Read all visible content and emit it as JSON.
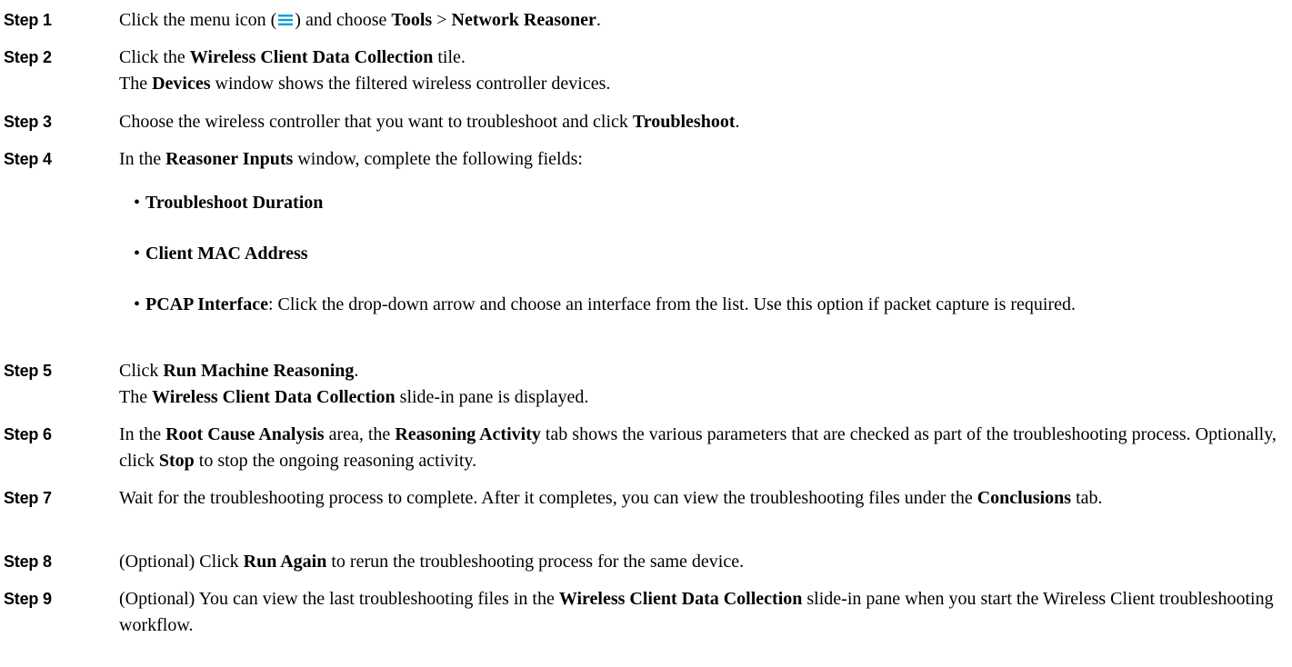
{
  "menu_icon_color": "#049fd9",
  "steps": [
    {
      "label": "Step 1",
      "parts": {
        "t1": "Click the menu icon (",
        "t2": ") and choose ",
        "b1": "Tools",
        "t3": " > ",
        "b2": "Network Reasoner",
        "t4": "."
      }
    },
    {
      "label": "Step 2",
      "parts": {
        "t1": "Click the ",
        "b1": "Wireless Client Data Collection",
        "t2": " tile.",
        "t3": "The ",
        "b2": "Devices",
        "t4": " window shows the filtered wireless controller devices."
      }
    },
    {
      "label": "Step 3",
      "parts": {
        "t1": "Choose the wireless controller that you want to troubleshoot and click ",
        "b1": "Troubleshoot",
        "t2": "."
      }
    },
    {
      "label": "Step 4",
      "parts": {
        "t1": "In the ",
        "b1": "Reasoner Inputs",
        "t2": " window, complete the following fields:"
      },
      "bullets": [
        {
          "bold": "Troubleshoot Duration",
          "text": ""
        },
        {
          "bold": "Client MAC Address",
          "text": ""
        },
        {
          "bold": "PCAP Interface",
          "text": ": Click the drop-down arrow and choose an interface from the list. Use this option if packet capture is required."
        }
      ]
    },
    {
      "label": "Step 5",
      "parts": {
        "t1": "Click ",
        "b1": "Run Machine Reasoning",
        "t2": ".",
        "t3": "The ",
        "b2": "Wireless Client Data Collection",
        "t4": " slide-in pane is displayed."
      }
    },
    {
      "label": "Step 6",
      "parts": {
        "t1": "In the ",
        "b1": "Root Cause Analysis",
        "t2": " area, the ",
        "b2": "Reasoning Activity",
        "t3": " tab shows the various parameters that are checked as part of the troubleshooting process. Optionally, click ",
        "b3": "Stop",
        "t4": " to stop the ongoing reasoning activity."
      }
    },
    {
      "label": "Step 7",
      "parts": {
        "t1": "Wait for the troubleshooting process to complete. After it completes, you can view the troubleshooting files under the ",
        "b1": "Conclusions",
        "t2": " tab."
      }
    },
    {
      "label": "Step 8",
      "parts": {
        "t1": "(Optional) Click ",
        "b1": "Run Again",
        "t2": " to rerun the troubleshooting process for the same device."
      }
    },
    {
      "label": "Step 9",
      "parts": {
        "t1": "(Optional) You can view the last troubleshooting files in the ",
        "b1": "Wireless Client Data Collection",
        "t2": " slide-in pane when you start the Wireless Client troubleshooting workflow."
      }
    }
  ]
}
